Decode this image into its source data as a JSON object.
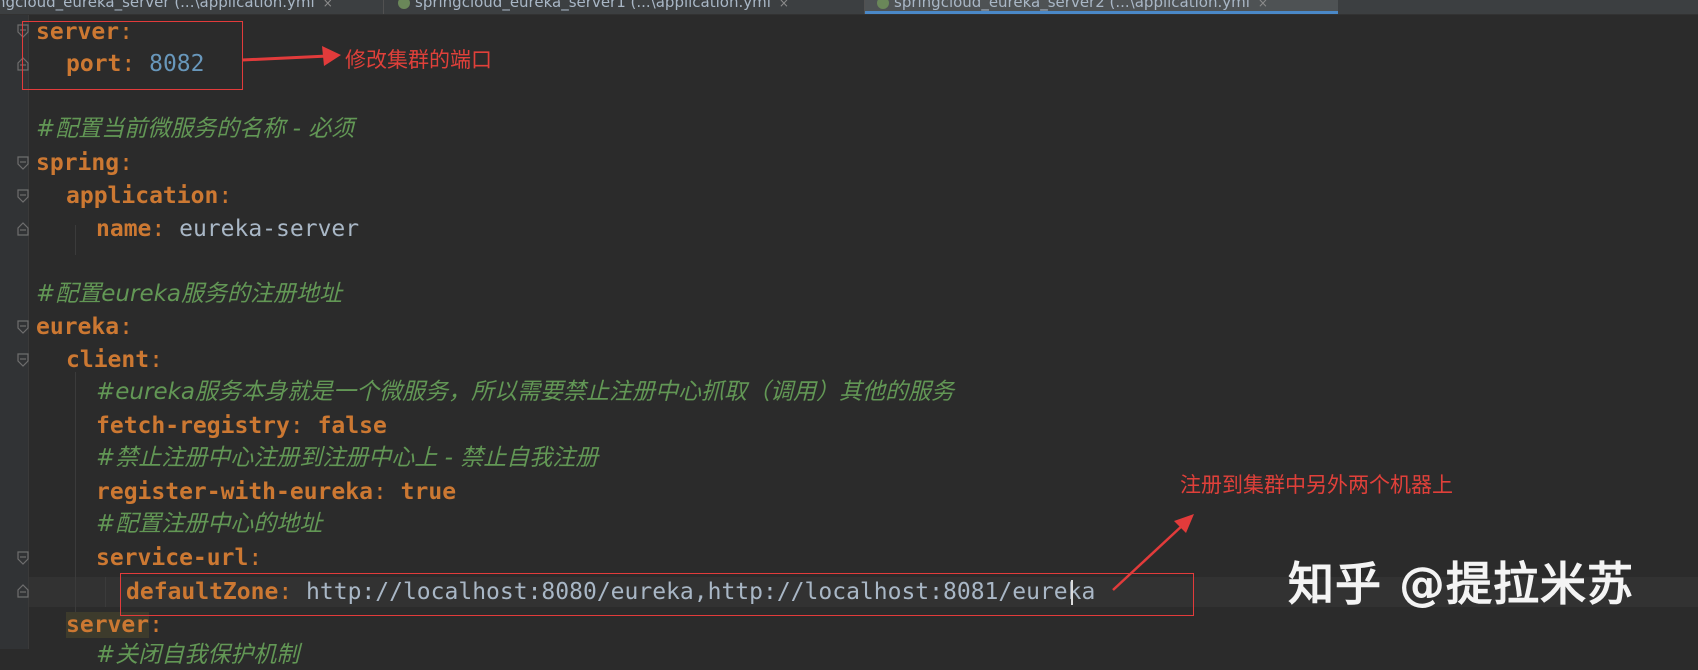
{
  "tabs": [
    {
      "label": "ngcloud_eureka_server (...\\application.yml",
      "close": "×"
    },
    {
      "label": "springcloud_eureka_server1 (...\\application.yml",
      "close": "×"
    },
    {
      "label": "springcloud_eureka_server2 (...\\application.yml",
      "close": "×"
    }
  ],
  "code": {
    "server_key": "server",
    "port_key": "port",
    "port_value": "8082",
    "comment_name": "#配置当前微服务的名称 - 必须",
    "spring_key": "spring",
    "application_key": "application",
    "name_key": "name",
    "name_value": "eureka-server",
    "comment_registry": "#配置eureka服务的注册地址",
    "eureka_key": "eureka",
    "client_key": "client",
    "comment_client": "#eureka服务本身就是一个微服务，所以需要禁止注册中心抓取（调用）其他的服务",
    "fetch_registry_key": "fetch-registry",
    "fetch_registry_value": "false",
    "comment_self_register": "#禁止注册中心注册到注册中心上 - 禁止自我注册",
    "register_with_eureka_key": "register-with-eureka",
    "register_with_eureka_value": "true",
    "comment_address": "#配置注册中心的地址",
    "service_url_key": "service-url",
    "default_zone_key": "defaultZone",
    "default_zone_value": "http://localhost:8080/eureka,http://localhost:8081/eureka",
    "server2_key": "server",
    "partial_comment": "#关闭自我保护机制"
  },
  "annotations": {
    "port_note": "修改集群的端口",
    "cluster_note": "注册到集群中另外两个机器上"
  },
  "watermark": "知乎 @提拉米苏",
  "colors": {
    "background": "#2b2b2b",
    "key": "#cc7832",
    "number": "#6897bb",
    "comment": "#629755",
    "text": "#a9b7c6",
    "annotation": "#e23b3b"
  }
}
